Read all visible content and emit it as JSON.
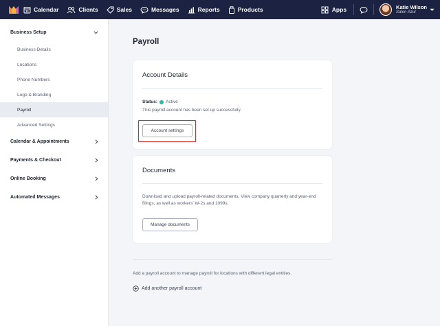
{
  "nav": {
    "items": [
      {
        "label": "Calendar",
        "icon": "calendar-icon"
      },
      {
        "label": "Clients",
        "icon": "clients-icon"
      },
      {
        "label": "Sales",
        "icon": "tag-icon"
      },
      {
        "label": "Messages",
        "icon": "messages-icon"
      },
      {
        "label": "Reports",
        "icon": "reports-icon"
      },
      {
        "label": "Products",
        "icon": "products-icon"
      }
    ],
    "apps_label": "Apps",
    "user": {
      "name": "Katie Wilson",
      "org": "Salon Azul"
    }
  },
  "sidebar": {
    "sections": [
      {
        "label": "Business Setup"
      },
      {
        "label": "Calendar & Appointments"
      },
      {
        "label": "Payments & Checkout"
      },
      {
        "label": "Online Booking"
      },
      {
        "label": "Automated Messages"
      }
    ],
    "subitems": [
      {
        "label": "Business Details"
      },
      {
        "label": "Locations"
      },
      {
        "label": "Phone Numbers"
      },
      {
        "label": "Logo & Branding"
      },
      {
        "label": "Payroll"
      },
      {
        "label": "Advanced Settings"
      }
    ]
  },
  "main": {
    "title": "Payroll",
    "account": {
      "title": "Account Details",
      "status_label": "Status:",
      "status_value": "Active",
      "status_color": "#2bb9a3",
      "description": "This payroll account has been set up successfully.",
      "button": "Account settings"
    },
    "documents": {
      "title": "Documents",
      "description": "Download and upload payroll-related documents. View company quarterly and year-end filings, as well as workers' W-2s and 1099s.",
      "button": "Manage documents"
    },
    "footer_note": "Add a payroll account to manage payroll for locations with different legal entities.",
    "add_link": "Add another payroll account"
  },
  "colors": {
    "nav_bg": "#1b2242",
    "highlight": "#d92a2a"
  }
}
